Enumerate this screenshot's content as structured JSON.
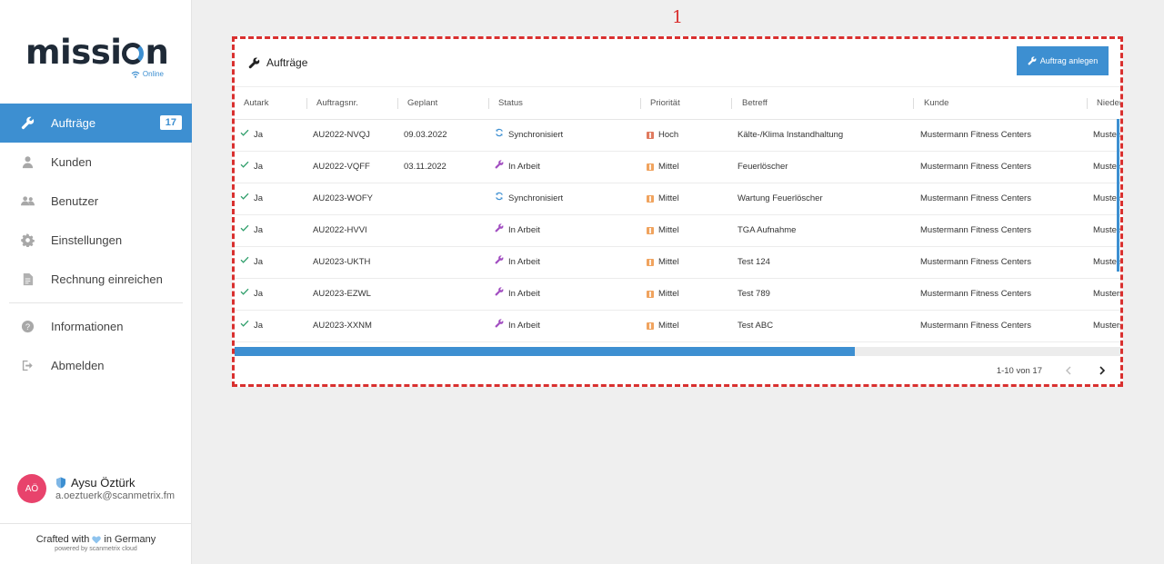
{
  "app": {
    "logo": "mission",
    "status": "Online"
  },
  "sidebar": {
    "items": [
      {
        "label": "Aufträge",
        "badge": "17",
        "icon": "wrench-icon"
      },
      {
        "label": "Kunden",
        "icon": "person-icon"
      },
      {
        "label": "Benutzer",
        "icon": "users-icon"
      },
      {
        "label": "Einstellungen",
        "icon": "gear-icon"
      },
      {
        "label": "Rechnung einreichen",
        "icon": "document-icon"
      },
      {
        "label": "Informationen",
        "icon": "help-icon"
      },
      {
        "label": "Abmelden",
        "icon": "logout-icon"
      }
    ]
  },
  "user": {
    "initials": "AÖ",
    "name": "Aysu Öztürk",
    "email": "a.oeztuerk@scanmetrix.fm"
  },
  "footer": {
    "crafted_prefix": "Crafted with",
    "crafted_suffix": "in Germany",
    "powered": "powered by scanmetrix cloud"
  },
  "annotation": "1",
  "card": {
    "title": "Aufträge",
    "create_button": "Auftrag anlegen"
  },
  "table": {
    "columns": [
      "Autark",
      "Auftragsnr.",
      "Geplant",
      "Status",
      "Priorität",
      "Betreff",
      "Kunde",
      "Nieder"
    ],
    "rows": [
      {
        "autark": "Ja",
        "nr": "AU2022-NVQJ",
        "geplant": "09.03.2022",
        "status": "Synchronisiert",
        "status_icon": "sync-icon",
        "prio": "Hoch",
        "prio_color": "#e07a5f",
        "betreff": "Kälte-/Klima Instandhaltung",
        "kunde": "Mustermann Fitness Centers",
        "nieder": "Musters"
      },
      {
        "autark": "Ja",
        "nr": "AU2022-VQFF",
        "geplant": "03.11.2022",
        "status": "In Arbeit",
        "status_icon": "wrench-icon",
        "prio": "Mittel",
        "prio_color": "#f0a35e",
        "betreff": "Feuerlöscher",
        "kunde": "Mustermann Fitness Centers",
        "nieder": "Musters"
      },
      {
        "autark": "Ja",
        "nr": "AU2023-WOFY",
        "geplant": "",
        "status": "Synchronisiert",
        "status_icon": "sync-icon",
        "prio": "Mittel",
        "prio_color": "#f0a35e",
        "betreff": "Wartung Feuerlöscher",
        "kunde": "Mustermann Fitness Centers",
        "nieder": "Musters"
      },
      {
        "autark": "Ja",
        "nr": "AU2022-HVVI",
        "geplant": "",
        "status": "In Arbeit",
        "status_icon": "wrench-icon",
        "prio": "Mittel",
        "prio_color": "#f0a35e",
        "betreff": "TGA Aufnahme",
        "kunde": "Mustermann Fitness Centers",
        "nieder": "Musters"
      },
      {
        "autark": "Ja",
        "nr": "AU2023-UKTH",
        "geplant": "",
        "status": "In Arbeit",
        "status_icon": "wrench-icon",
        "prio": "Mittel",
        "prio_color": "#f0a35e",
        "betreff": "Test 124",
        "kunde": "Mustermann Fitness Centers",
        "nieder": "Musters"
      },
      {
        "autark": "Ja",
        "nr": "AU2023-EZWL",
        "geplant": "",
        "status": "In Arbeit",
        "status_icon": "wrench-icon",
        "prio": "Mittel",
        "prio_color": "#f0a35e",
        "betreff": "Test 789",
        "kunde": "Mustermann Fitness Centers",
        "nieder": "Musters"
      },
      {
        "autark": "Ja",
        "nr": "AU2023-XXNM",
        "geplant": "",
        "status": "In Arbeit",
        "status_icon": "wrench-icon",
        "prio": "Mittel",
        "prio_color": "#f0a35e",
        "betreff": "Test ABC",
        "kunde": "Mustermann Fitness Centers",
        "nieder": "Musters"
      }
    ],
    "horizontal_scroll_fraction": 0.7
  },
  "pagination": {
    "range": "1-10 von 17"
  },
  "colors": {
    "accent": "#3d8fd1",
    "annotation": "#d9302f",
    "sync": "#3d8fd1",
    "in_progress": "#a24fc1",
    "check": "#2e9e6a"
  }
}
